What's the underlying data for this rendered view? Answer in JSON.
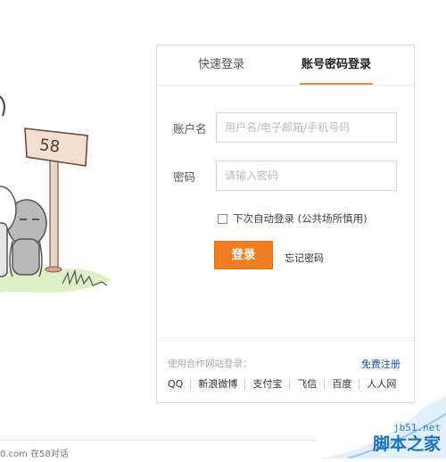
{
  "illustration": {
    "sign_text": "58"
  },
  "tabs": [
    {
      "label": "快速登录",
      "active": false
    },
    {
      "label": "账号密码登录",
      "active": true
    }
  ],
  "form": {
    "username_label": "账户名",
    "username_placeholder": "用户名/电子邮箱/手机号码",
    "password_label": "密码",
    "password_placeholder": "请输入密码",
    "auto_login_label": "下次自动登录 (公共场所慎用)",
    "auto_login_checked": false,
    "login_button": "登录",
    "forgot_link": "忘记密码"
  },
  "footer": {
    "partner_label": "使用合作网站登录：",
    "register_link": "免费注册",
    "providers": [
      "QQ",
      "新浪微博",
      "支付宝",
      "飞信",
      "百度",
      "人人网"
    ]
  },
  "page_footer": {
    "text": "0.com 在58对话"
  },
  "watermark": {
    "site": "jb51.net",
    "name": "脚本之家"
  },
  "colors": {
    "accent": "#f07d20",
    "link": "#1450aa",
    "watermark": "#1a6fc4"
  }
}
